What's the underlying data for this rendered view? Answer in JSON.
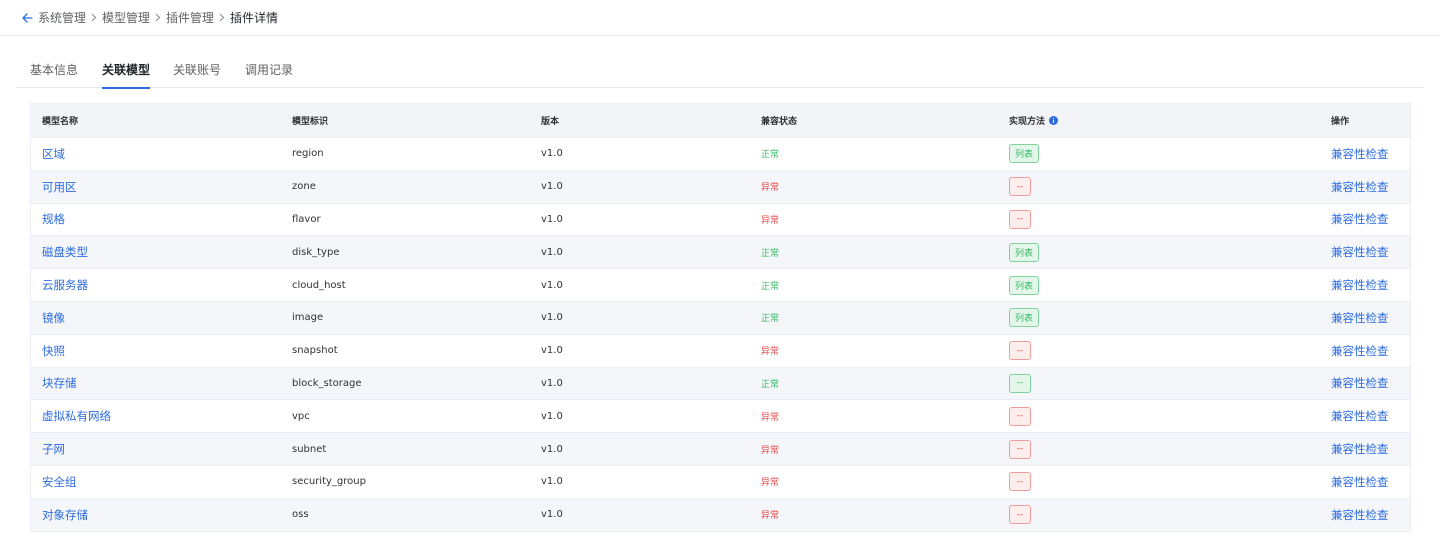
{
  "breadcrumb": [
    "系统管理",
    "模型管理",
    "插件管理",
    "插件详情"
  ],
  "tabs": [
    {
      "label": "基本信息",
      "active": false
    },
    {
      "label": "关联模型",
      "active": true
    },
    {
      "label": "关联账号",
      "active": false
    },
    {
      "label": "调用记录",
      "active": false
    }
  ],
  "table": {
    "headers": {
      "name": "模型名称",
      "id": "模型标识",
      "version": "版本",
      "compat": "兼容状态",
      "method": "实现方法",
      "ops": "操作"
    },
    "rows": [
      {
        "name": "区域",
        "id": "region",
        "version": "v1.0",
        "compat": "正常",
        "method": "列表",
        "ok": true,
        "op": "兼容性检查"
      },
      {
        "name": "可用区",
        "id": "zone",
        "version": "v1.0",
        "compat": "异常",
        "method": "--",
        "ok": false,
        "op": "兼容性检查"
      },
      {
        "name": "规格",
        "id": "flavor",
        "version": "v1.0",
        "compat": "异常",
        "method": "--",
        "ok": false,
        "op": "兼容性检查"
      },
      {
        "name": "磁盘类型",
        "id": "disk_type",
        "version": "v1.0",
        "compat": "正常",
        "method": "列表",
        "ok": true,
        "op": "兼容性检查"
      },
      {
        "name": "云服务器",
        "id": "cloud_host",
        "version": "v1.0",
        "compat": "正常",
        "method": "列表",
        "ok": true,
        "op": "兼容性检查"
      },
      {
        "name": "镜像",
        "id": "image",
        "version": "v1.0",
        "compat": "正常",
        "method": "列表",
        "ok": true,
        "op": "兼容性检查"
      },
      {
        "name": "快照",
        "id": "snapshot",
        "version": "v1.0",
        "compat": "异常",
        "method": "--",
        "ok": false,
        "op": "兼容性检查"
      },
      {
        "name": "块存储",
        "id": "block_storage",
        "version": "v1.0",
        "compat": "正常",
        "method": "--",
        "ok": true,
        "op": "兼容性检查"
      },
      {
        "name": "虚拟私有网络",
        "id": "vpc",
        "version": "v1.0",
        "compat": "异常",
        "method": "--",
        "ok": false,
        "op": "兼容性检查"
      },
      {
        "name": "子网",
        "id": "subnet",
        "version": "v1.0",
        "compat": "异常",
        "method": "--",
        "ok": false,
        "op": "兼容性检查"
      },
      {
        "name": "安全组",
        "id": "security_group",
        "version": "v1.0",
        "compat": "异常",
        "method": "--",
        "ok": false,
        "op": "兼容性检查"
      },
      {
        "name": "对象存储",
        "id": "oss",
        "version": "v1.0",
        "compat": "异常",
        "method": "--",
        "ok": false,
        "op": "兼容性检查"
      }
    ]
  },
  "colors": {
    "link": "#2c6be0",
    "ok": "#34b864",
    "bad": "#e34d4d"
  },
  "icons": {
    "back": "arrow-left-icon",
    "separator": "chevron-right-icon",
    "info": "info-icon"
  }
}
